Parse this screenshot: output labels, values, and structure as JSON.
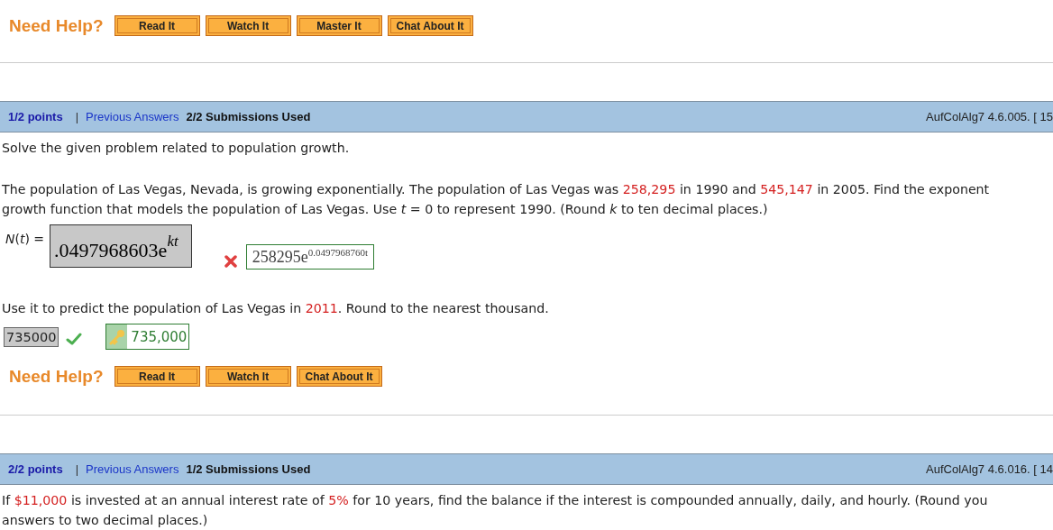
{
  "questions": [
    {
      "help": {
        "label": "Need Help?",
        "buttons": [
          "Read It",
          "Watch It",
          "Master It",
          "Chat About It"
        ]
      }
    },
    {
      "header": {
        "points": "1/2 points",
        "separator": "|",
        "link": "Previous Answers",
        "submissions": "2/2 Submissions Used",
        "code": "AufColAlg7 4.6.005. [ 15"
      },
      "intro": "Solve the given problem related to population growth.",
      "paragraph": [
        [
          {
            "text": "The population of Las Vegas, Nevada, is growing exponentially. The population of Las Vegas was ",
            "red": false
          },
          {
            "text": "258,295",
            "red": true
          },
          {
            "text": " in 1990 and ",
            "red": false
          },
          {
            "text": "545,147",
            "red": true
          },
          {
            "text": " in 2005. Find the exponent",
            "red": false
          }
        ],
        [
          {
            "text": "growth function that models the population of Las Vegas. Use *t* = 0 to represent 1990. (Round *k* to ten decimal places.)",
            "red": false
          }
        ]
      ],
      "answers": [
        {
          "kind": "formula",
          "label": "*N*(*t*) =",
          "value": ".0497968603e$^{kt}$",
          "correct": false,
          "key": "258295e$^{0.0497968760t}$"
        },
        {
          "prompt": [
            {
              "text": "Use it to predict the population of Las Vegas in ",
              "red": false
            },
            {
              "text": "2011",
              "red": true
            },
            {
              "text": ". Round to the nearest thousand.",
              "red": false
            }
          ]
        },
        {
          "kind": "number",
          "value": "735000",
          "correct": true,
          "key": "735,000"
        }
      ],
      "help": {
        "label": "Need Help?",
        "buttons": [
          "Read It",
          "Watch It",
          "Chat About It"
        ]
      }
    },
    {
      "header": {
        "points": "2/2 points",
        "separator": "|",
        "link": "Previous Answers",
        "submissions": "1/2 Submissions Used",
        "code": "AufColAlg7 4.6.016. [ 14"
      },
      "paragraph": [
        [
          {
            "text": "If ",
            "red": false
          },
          {
            "text": "$11,000",
            "red": true
          },
          {
            "text": " is invested at an annual interest rate of ",
            "red": false
          },
          {
            "text": "5%",
            "red": true
          },
          {
            "text": " for 10 years, find the balance if the interest is compounded annually, daily, and hourly. (Round you",
            "red": false
          }
        ],
        [
          {
            "text": "answers to two decimal places.)",
            "red": false
          }
        ]
      ]
    }
  ]
}
